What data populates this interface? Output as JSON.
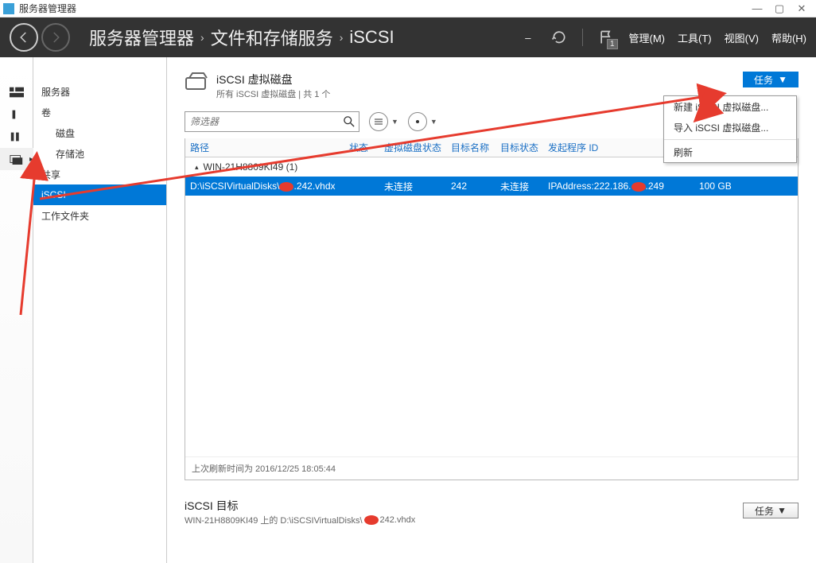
{
  "app": {
    "title": "服务器管理器"
  },
  "win": {
    "min": "—",
    "max": "▢",
    "close": "✕"
  },
  "header": {
    "breadcrumb": [
      "服务器管理器",
      "文件和存储服务",
      "iSCSI"
    ],
    "dropdown_dash": "–",
    "menus": {
      "manage": "管理(M)",
      "tools": "工具(T)",
      "view": "视图(V)",
      "help": "帮助(H)"
    },
    "notif_count": "1"
  },
  "nav": {
    "items": [
      {
        "label": "服务器"
      },
      {
        "label": "卷"
      },
      {
        "label": "磁盘",
        "sub": true
      },
      {
        "label": "存储池",
        "sub": true
      },
      {
        "label": "共享"
      },
      {
        "label": "iSCSI",
        "selected": true
      },
      {
        "label": "工作文件夹"
      }
    ]
  },
  "section": {
    "title": "iSCSI 虚拟磁盘",
    "subtitle": "所有 iSCSI 虚拟磁盘 | 共 1 个",
    "tasks_label": "任务"
  },
  "filter": {
    "placeholder": "筛选器"
  },
  "ctxmenu": {
    "new": "新建 iSCSI 虚拟磁盘...",
    "import": "导入 iSCSI 虚拟磁盘...",
    "refresh": "刷新"
  },
  "columns": {
    "path": "路径",
    "status": "状态",
    "vdisk": "虚拟磁盘状态",
    "tname": "目标名称",
    "tstat": "目标状态",
    "iqn": "发起程序 ID"
  },
  "group": {
    "label": "WIN-21H8809KI49 (1)"
  },
  "row": {
    "path_pre": "D:\\iSCSIVirtualDisks\\",
    "path_post": ".242.vhdx",
    "vdisk": "未连接",
    "tname": "242",
    "tstat": "未连接",
    "iqn_pre": "IPAddress:222.186.",
    "iqn_post": ".249",
    "size": "100 GB"
  },
  "footer": {
    "text": "上次刷新时间为 2016/12/25 18:05:44"
  },
  "lower": {
    "title": "iSCSI 目标",
    "sub_pre": "WIN-21H8809KI49 上的 D:\\iSCSIVirtualDisks\\",
    "sub_post": "242.vhdx",
    "tasks": "任务"
  }
}
